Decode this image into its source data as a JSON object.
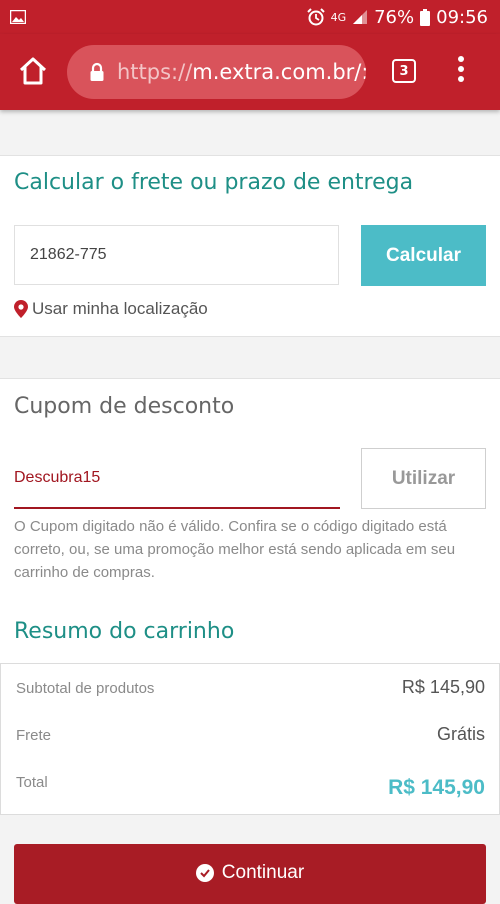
{
  "status_bar": {
    "network": "4G",
    "battery": "76%",
    "time": "09:56"
  },
  "browser": {
    "url_protocol": "https://",
    "url_host": "m.extra.com.br/:",
    "tab_count": "3"
  },
  "shipping": {
    "title": "Calcular o frete ou prazo de entrega",
    "cep_value": "21862-775",
    "calculate_label": "Calcular",
    "location_label": "Usar minha localização"
  },
  "coupon": {
    "title": "Cupom de desconto",
    "code_value": "Descubra15",
    "use_label": "Utilizar",
    "error_message": "O Cupom digitado não é válido. Confira se o código digitado está correto, ou, se uma promoção melhor está sendo aplicada em seu carrinho de compras."
  },
  "summary": {
    "title": "Resumo do carrinho",
    "subtotal_label": "Subtotal de produtos",
    "subtotal_value": "R$ 145,90",
    "shipping_label": "Frete",
    "shipping_value": "Grátis",
    "total_label": "Total",
    "total_value": "R$ 145,90"
  },
  "continue_label": "Continuar",
  "colors": {
    "brand_red": "#c0202b",
    "teal": "#1e8f86",
    "accent_cyan": "#4cbcc7",
    "button_red": "#a81c25"
  },
  "icons": [
    "image-icon",
    "alarm-icon",
    "signal-icon",
    "battery-icon",
    "home-icon",
    "lock-icon",
    "tabs-icon",
    "more-vert-icon",
    "location-pin-icon",
    "check-circle-icon"
  ]
}
